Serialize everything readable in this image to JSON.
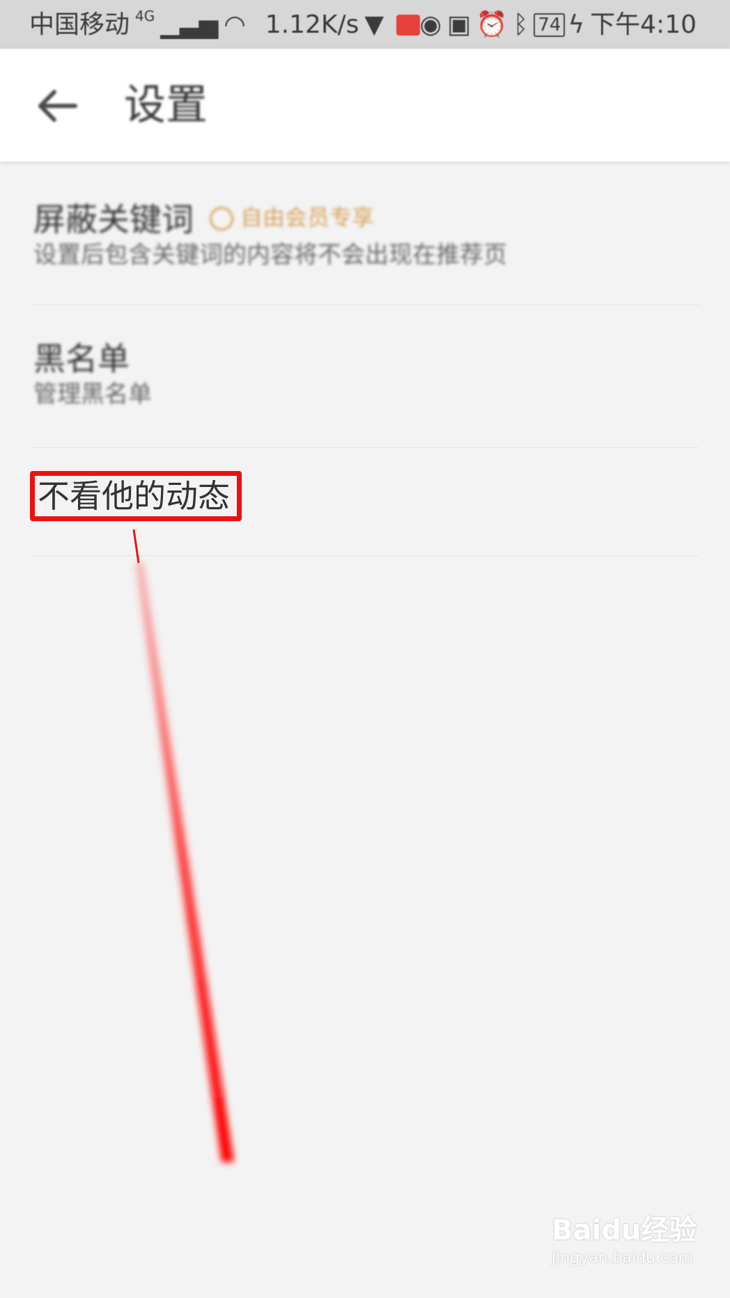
{
  "status_bar": {
    "carrier": "中国移动",
    "network": "4G",
    "net_speed": "1.12K/s",
    "battery": "74",
    "time": "下午4:10"
  },
  "app_bar": {
    "title": "设置",
    "back_icon": "arrow-left-icon"
  },
  "settings": {
    "items": [
      {
        "title": "屏蔽关键词",
        "badge": "自由会员专享",
        "subtitle": "设置后包含关键词的内容将不会出现在推荐页"
      },
      {
        "title": "黑名单",
        "subtitle": "管理黑名单"
      },
      {
        "title": "不看他的动态"
      }
    ]
  },
  "annotation": {
    "color": "#ee1010"
  },
  "watermark": {
    "logo": "Baidu经验",
    "url": "jingyan.baidu.com"
  }
}
